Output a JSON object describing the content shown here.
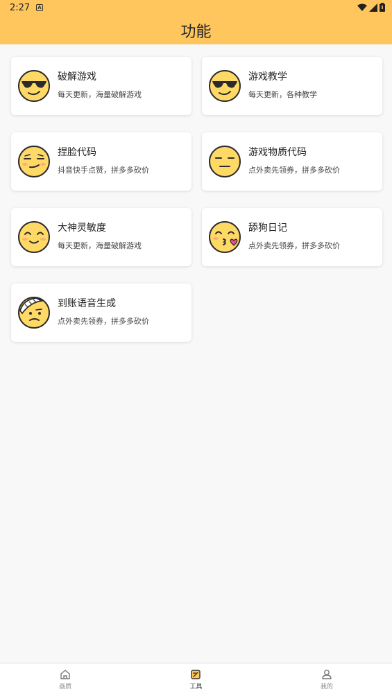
{
  "status": {
    "time": "2:27"
  },
  "header": {
    "title": "功能"
  },
  "cards": [
    {
      "title": "破解游戏",
      "subtitle": "每天更新，海量破解游戏",
      "icon": "sunglasses-face-icon"
    },
    {
      "title": "游戏教学",
      "subtitle": "每天更新，各种教学",
      "icon": "sunglasses-face-icon"
    },
    {
      "title": "捏脸代码",
      "subtitle": "抖音快手点赞，拼多多砍价",
      "icon": "smirk-face-icon"
    },
    {
      "title": "游戏物质代码",
      "subtitle": "点外卖先领券，拼多多砍价",
      "icon": "expressionless-face-icon"
    },
    {
      "title": "大神灵敏度",
      "subtitle": "每天更新，海量破解游戏",
      "icon": "relieved-face-icon"
    },
    {
      "title": "舔狗日记",
      "subtitle": "点外卖先领券，拼多多砍价",
      "icon": "kissing-heart-face-icon"
    },
    {
      "title": "到账语音生成",
      "subtitle": "点外卖先领券，拼多多砍价",
      "icon": "bandaged-face-icon"
    }
  ],
  "nav": {
    "items": [
      {
        "label": "画质",
        "icon": "home-icon",
        "active": false
      },
      {
        "label": "工具",
        "icon": "tools-icon",
        "active": true
      },
      {
        "label": "我的",
        "icon": "user-icon",
        "active": false
      }
    ]
  },
  "colors": {
    "accent": "#ffc65e",
    "face": "#ffd966",
    "face_outline": "#2b2b2b",
    "blush": "#ffa07a"
  }
}
